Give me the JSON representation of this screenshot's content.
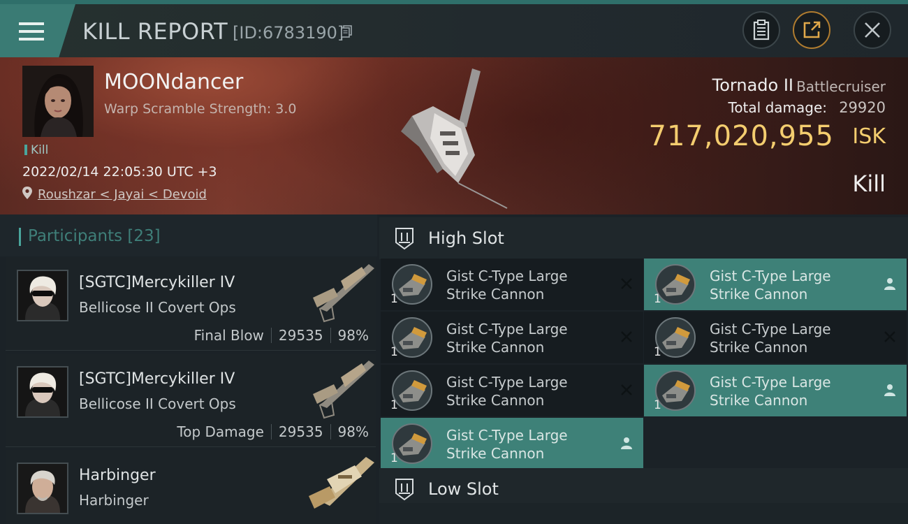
{
  "header": {
    "title": "KILL REPORT",
    "report_id": "[ID:6783190]"
  },
  "victim": {
    "name": "MOONdancer",
    "scramble": "Warp Scramble Strength: 3.0",
    "result_tag": "Kill",
    "datetime": "2022/02/14 22:05:30 UTC +3",
    "location": "Roushzar < Jayai < Devoid",
    "ship_name": "Tornado II",
    "ship_class": "Battlecruiser",
    "total_damage_label": "Total damage:",
    "total_damage": "29920",
    "isk_value": "717,020,955",
    "isk_unit": "ISK",
    "result": "Kill"
  },
  "participants": {
    "label": "Participants",
    "count": "[23]",
    "rows": [
      {
        "name": "[SGTC]Mercykiller IV",
        "ship": "Bellicose II Covert Ops",
        "tag": "Final Blow",
        "damage": "29535",
        "percent": "98%"
      },
      {
        "name": "[SGTC]Mercykiller IV",
        "ship": "Bellicose II Covert Ops",
        "tag": "Top Damage",
        "damage": "29535",
        "percent": "98%"
      },
      {
        "name": "Harbinger",
        "ship": "Harbinger",
        "tag": "",
        "damage": "",
        "percent": ""
      }
    ]
  },
  "slots": {
    "high_label": "High Slot",
    "low_label": "Low Slot",
    "modules": [
      {
        "line1": "Gist C-Type Large",
        "line2": "Strike Cannon",
        "qty": "1",
        "status": "destroyed"
      },
      {
        "line1": "Gist C-Type Large",
        "line2": "Strike Cannon",
        "qty": "1",
        "status": "dropped"
      },
      {
        "line1": "Gist C-Type Large",
        "line2": "Strike Cannon",
        "qty": "1",
        "status": "destroyed"
      },
      {
        "line1": "Gist C-Type Large",
        "line2": "Strike Cannon",
        "qty": "1",
        "status": "destroyed"
      },
      {
        "line1": "Gist C-Type Large",
        "line2": "Strike Cannon",
        "qty": "1",
        "status": "destroyed"
      },
      {
        "line1": "Gist C-Type Large",
        "line2": "Strike Cannon",
        "qty": "1",
        "status": "dropped"
      },
      {
        "line1": "Gist C-Type Large",
        "line2": "Strike Cannon",
        "qty": "1",
        "status": "dropped"
      }
    ]
  },
  "colors": {
    "accent": "#3e8178",
    "isk": "#f4cd6f"
  }
}
